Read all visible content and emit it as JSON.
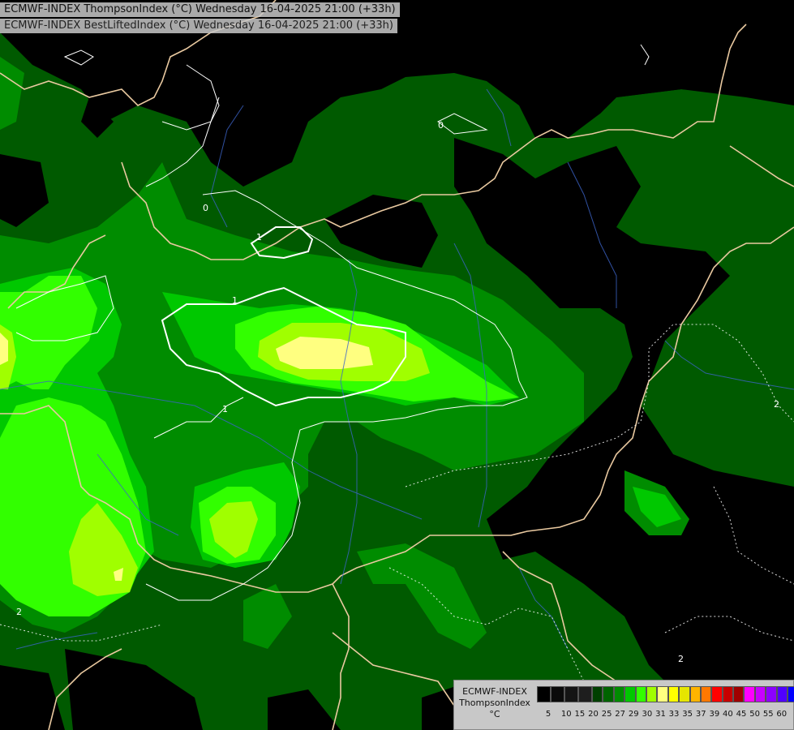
{
  "header": {
    "line1": "ECMWF-INDEX ThompsonIndex (°C) Wednesday 16-04-2025 21:00 (+33h)",
    "line2": "ECMWF-INDEX BestLiftedIndex (°C) Wednesday 16-04-2025 21:00 (+33h)"
  },
  "legend": {
    "title_lines": [
      "ECMWF-INDEX",
      "ThompsonIndex",
      "°C"
    ],
    "colors": [
      "#000000",
      "#0a0a0a",
      "#141414",
      "#1e1e1e",
      "#004000",
      "#006400",
      "#008c00",
      "#00c800",
      "#32ff00",
      "#a0ff00",
      "#ffff80",
      "#ffff00",
      "#e6e600",
      "#ffb400",
      "#ff7800",
      "#ff0000",
      "#c80000",
      "#a00000",
      "#ff00ff",
      "#c800ff",
      "#8c00ff",
      "#5000ff",
      "#0000ff"
    ],
    "ticks": [
      "5",
      "10",
      "15",
      "20",
      "25",
      "27",
      "29",
      "30",
      "31",
      "33",
      "35",
      "37",
      "39",
      "40",
      "45",
      "50",
      "55",
      "60"
    ]
  },
  "contour_labels": [
    "1",
    "1",
    "0",
    "0",
    "1",
    "2",
    "2",
    "2"
  ]
}
